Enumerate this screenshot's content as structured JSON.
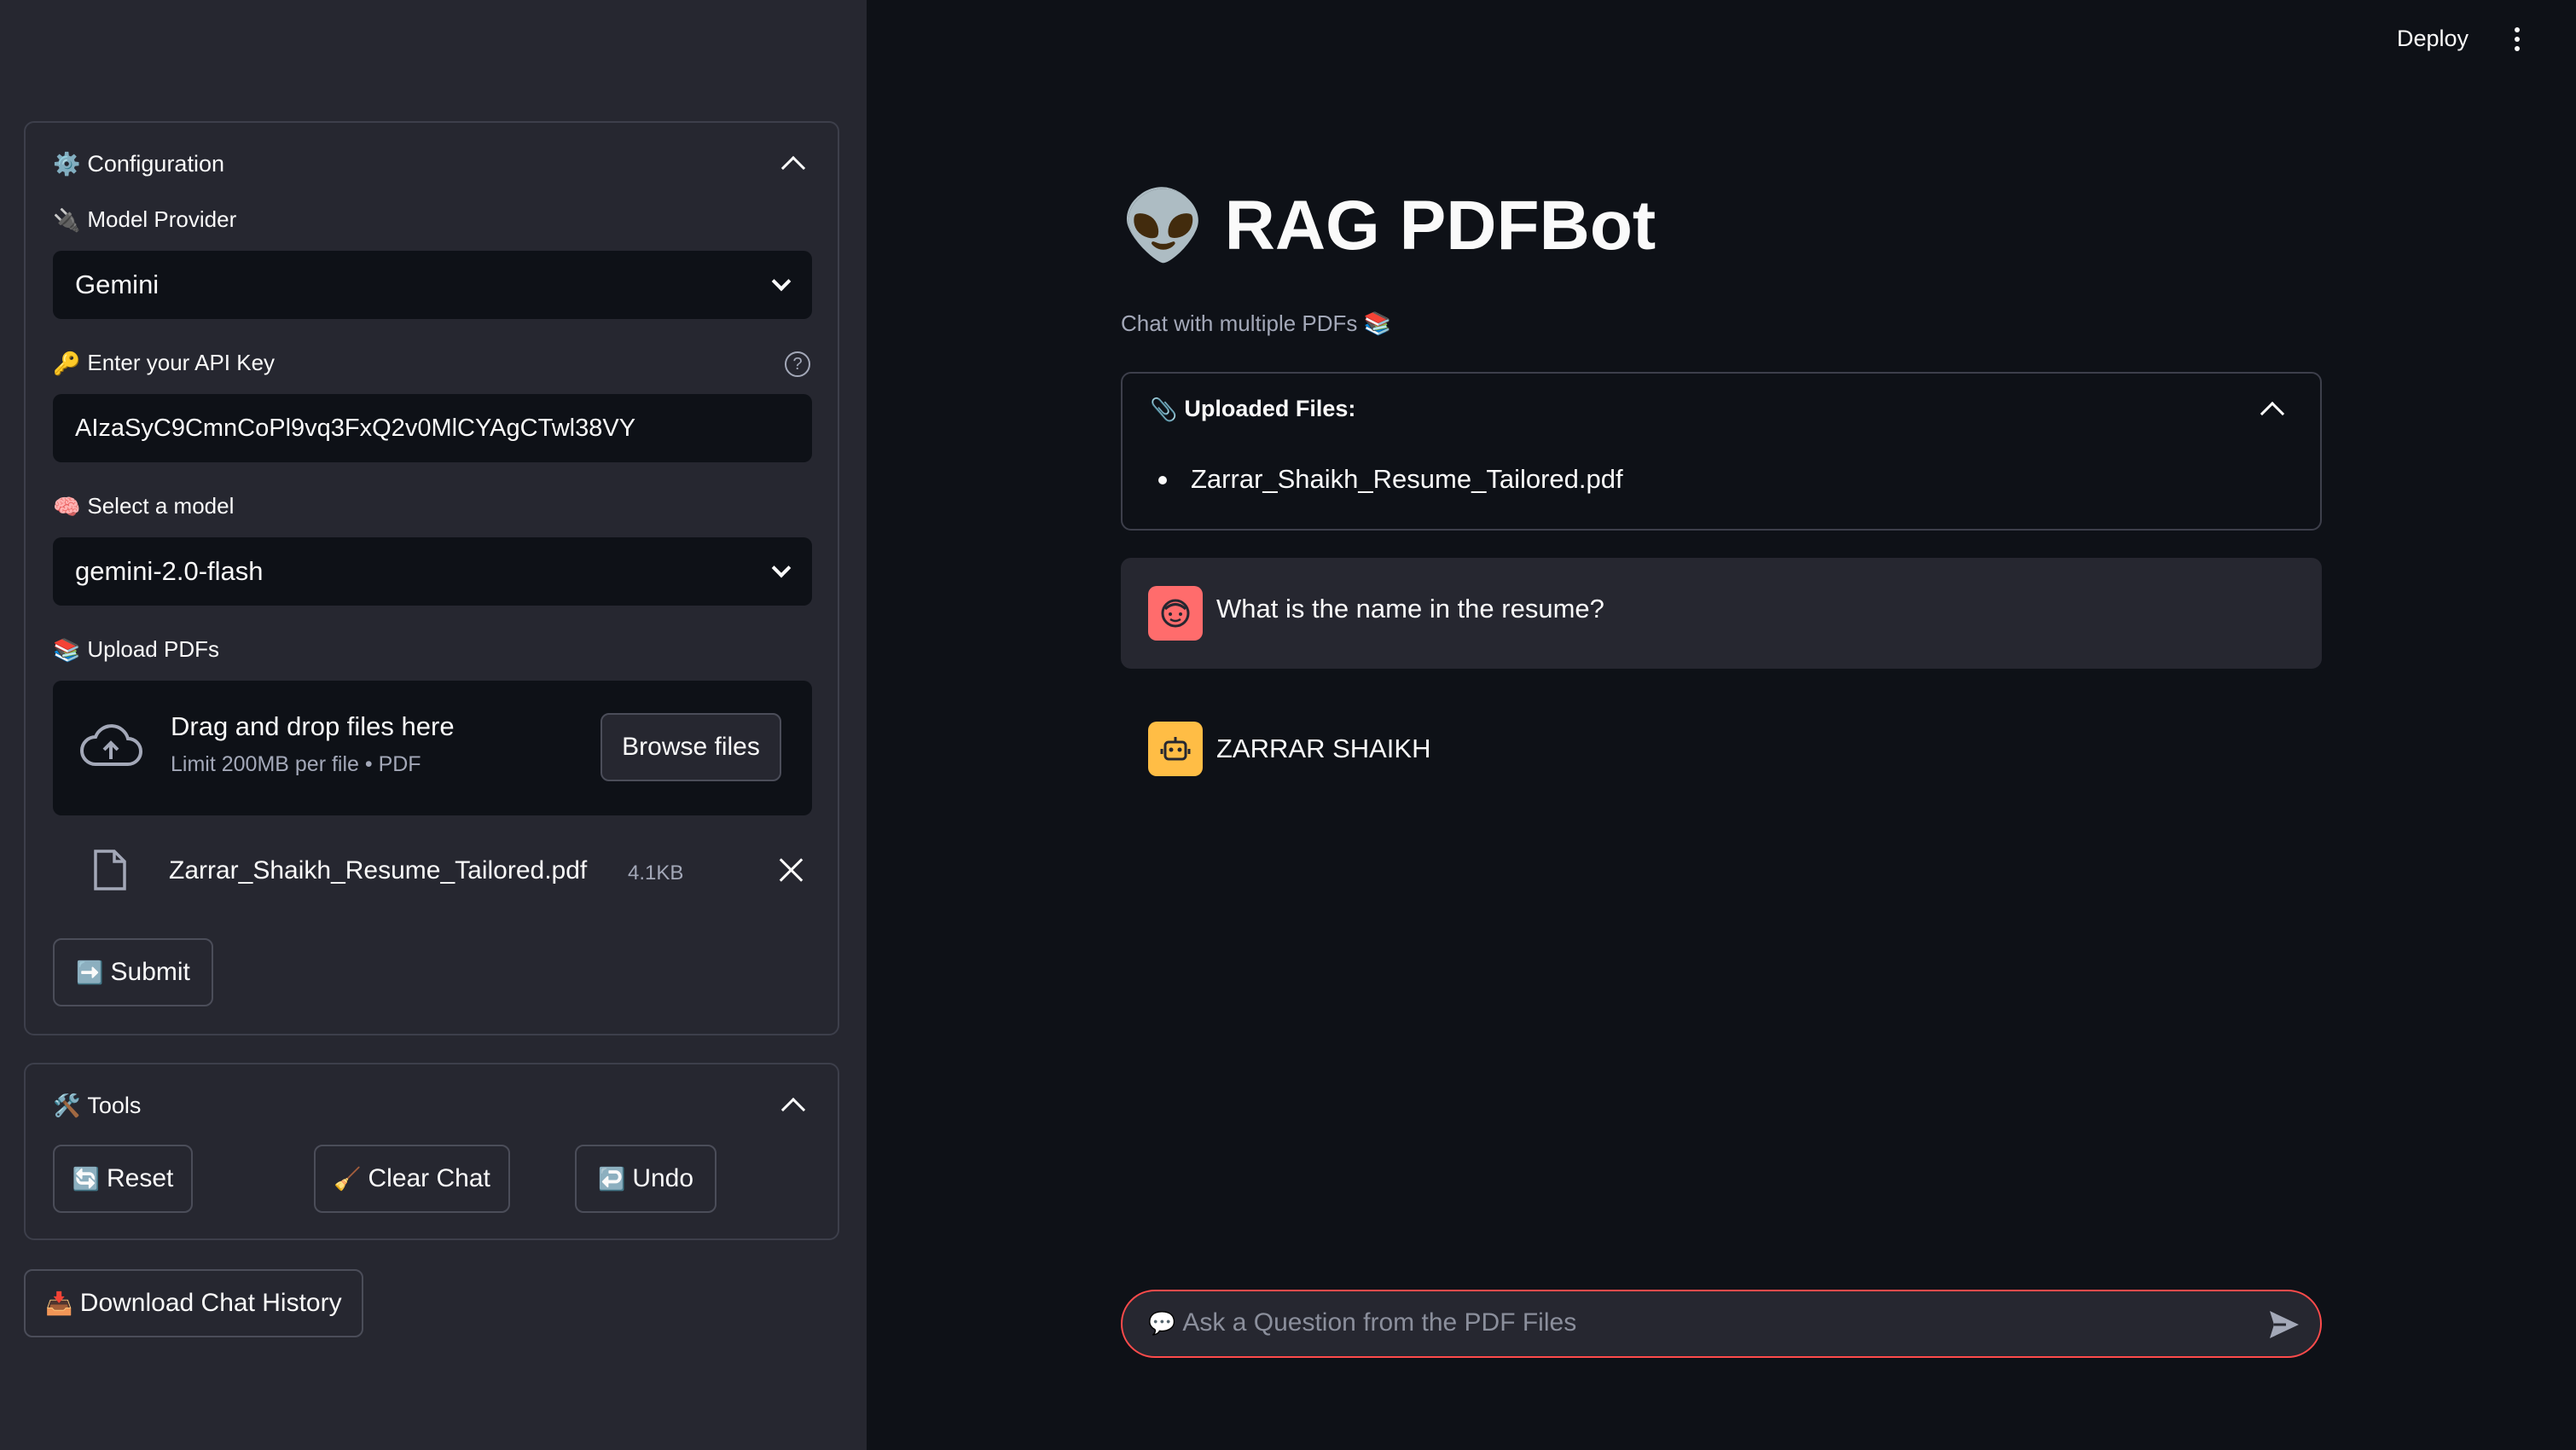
{
  "sidebar": {
    "config_panel": {
      "icon": "gear-icon",
      "title": "Configuration",
      "model_provider_label": "Model Provider",
      "model_provider_value": "Gemini",
      "api_key_label": "Enter your API Key",
      "api_key_value": "AIzaSyC9CmnCoPl9vq3FxQ2v0MlCYAgCTwl38VY",
      "model_label": "Select a model",
      "model_value": "gemini-2.0-flash",
      "upload_label": "Upload PDFs",
      "dropzone_title": "Drag and drop files here",
      "dropzone_sub": "Limit 200MB per file • PDF",
      "browse_label": "Browse files",
      "uploaded_file_name": "Zarrar_Shaikh_Resume_Tailored.pdf",
      "uploaded_file_size": "4.1KB",
      "submit_label": "Submit",
      "help_glyph": "?"
    },
    "tools_panel": {
      "title": "Tools",
      "reset_label": "Reset",
      "clear_label": "Clear Chat",
      "undo_label": "Undo"
    },
    "download_label": "Download Chat History"
  },
  "topbar": {
    "deploy_label": "Deploy"
  },
  "main": {
    "title_emoji": "👽",
    "title": "RAG PDFBot",
    "subtitle": "Chat with multiple PDFs 📚",
    "uploaded_files_title": "Uploaded Files:",
    "uploaded_files": [
      "Zarrar_Shaikh_Resume_Tailored.pdf"
    ],
    "messages": [
      {
        "role": "user",
        "text": "What is the name in the resume?"
      },
      {
        "role": "assistant",
        "text": "ZARRAR SHAIKH"
      }
    ],
    "chat_placeholder": "Ask a Question from the PDF Files"
  },
  "colors": {
    "sidebar_bg": "#262730",
    "main_bg": "#0e1117",
    "accent": "#ff4b4b",
    "user_avatar": "#ff6c6c",
    "assistant_avatar": "#ffbd45"
  }
}
